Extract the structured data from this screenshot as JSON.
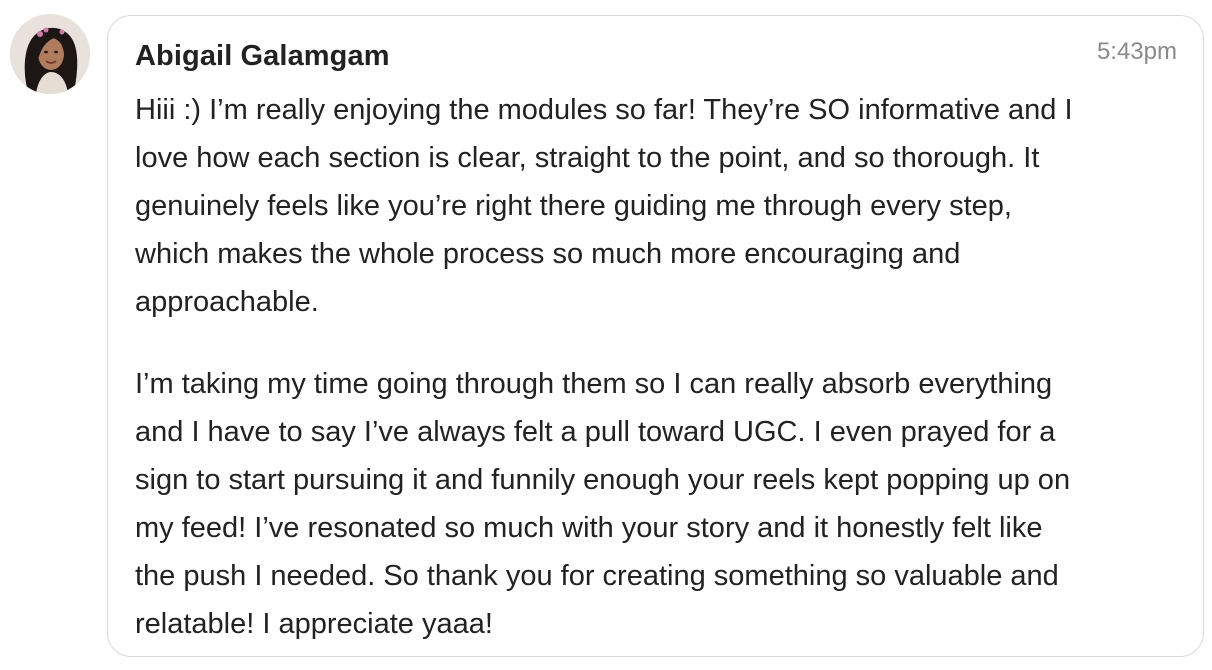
{
  "message": {
    "author": "Abigail Galamgam",
    "timestamp": "5:43pm",
    "paragraphs": [
      {
        "lines": [
          "Hiii :) I’m really enjoying the modules so far! They’re SO informative and I",
          "love how each section is clear, straight to the point, and so thorough. It",
          "genuinely feels like you’re right there guiding me through every step,",
          "which makes the whole process so much more encouraging and",
          "approachable."
        ]
      },
      {
        "lines": [
          "I’m taking my time going through them so I can really absorb everything",
          "and I have to say I’ve always felt a pull toward UGC. I even prayed for a",
          "sign to start pursuing it and funnily enough your reels kept popping up on",
          "my feed! I’ve resonated so much with your story and it honestly felt like",
          "the push I needed. So thank you for creating something so valuable and",
          "relatable! I appreciate yaaa!"
        ]
      }
    ]
  },
  "avatar": {
    "icon": "user-avatar-photo",
    "hair_color": "#1c1614",
    "skin_color": "#b07c5e",
    "background_color": "#e9e2dc",
    "accessory_color": "#d07aa8"
  },
  "colors": {
    "text": "#222222",
    "timestamp": "#8a8a8a",
    "bubble_border": "#d9d9d9"
  }
}
